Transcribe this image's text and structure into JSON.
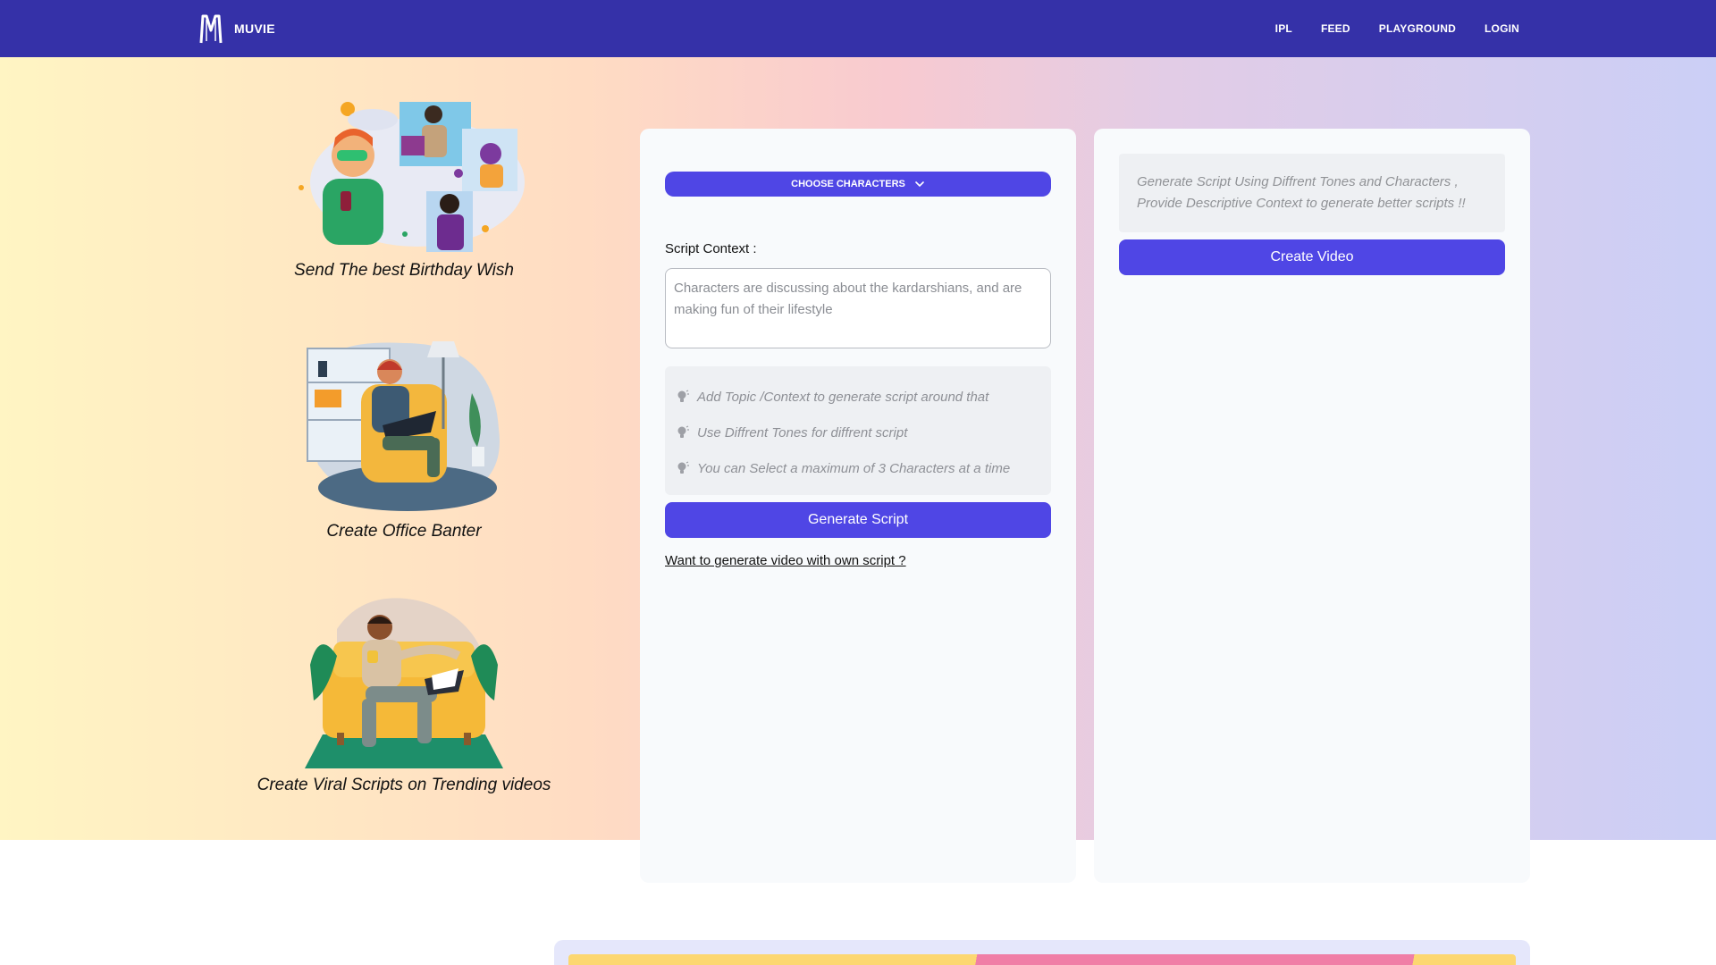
{
  "brand": {
    "name": "MUVIE",
    "logo_letter": "M"
  },
  "nav": {
    "links": [
      "IPL",
      "FEED",
      "PLAYGROUND",
      "LOGIN"
    ]
  },
  "features": [
    {
      "caption": "Send The best Birthday Wish"
    },
    {
      "caption": "Create Office Banter"
    },
    {
      "caption": "Create Viral Scripts on Trending videos"
    }
  ],
  "script_panel": {
    "choose_characters_label": "CHOOSE CHARACTERS",
    "context_label": "Script Context :",
    "context_placeholder": "Characters are discussing about the kardarshians, and are making fun of their lifestyle",
    "tips": [
      "Add Topic /Context to generate script around that",
      "Use Diffrent Tones for diffrent script",
      "You can Select a maximum of 3 Characters at a time"
    ],
    "generate_label": "Generate Script",
    "own_script_link": "Want to generate video with own script ?"
  },
  "video_panel": {
    "info_text": "Generate Script Using Diffrent Tones and Characters , Provide Descriptive Context to generate better scripts !!",
    "create_label": "Create Video"
  },
  "colors": {
    "nav": "#3531a8",
    "accent": "#4f46e5"
  },
  "icons": {
    "tip": "lightbulb-icon",
    "dropdown": "chevron-down-icon"
  }
}
